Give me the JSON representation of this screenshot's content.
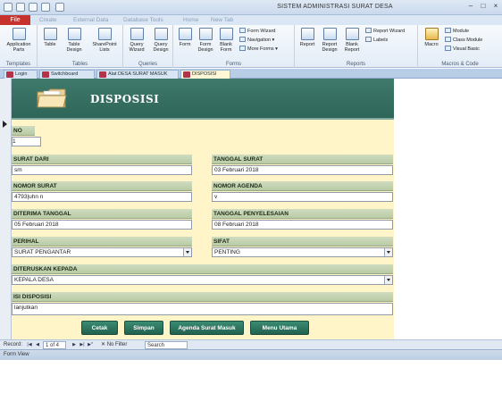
{
  "window": {
    "title": "SISTEM ADMINISTRASI SURAT DESA"
  },
  "ribbon": {
    "file_tab": "File",
    "tabs": [
      "Create",
      "External Data",
      "Database Tools",
      "Home",
      "New Tab"
    ],
    "groups": {
      "templates": {
        "label": "Templates",
        "buttons": [
          "Application Parts"
        ]
      },
      "tables": {
        "label": "Tables",
        "buttons": [
          "Table",
          "Table Design",
          "SharePoint Lists"
        ]
      },
      "queries": {
        "label": "Queries",
        "buttons": [
          "Query Wizard",
          "Query Design"
        ]
      },
      "forms": {
        "label": "Forms",
        "buttons": [
          "Form",
          "Form Design",
          "Blank Form"
        ],
        "small": [
          "Form Wizard",
          "Navigation",
          "More Forms"
        ]
      },
      "reports": {
        "label": "Reports",
        "buttons": [
          "Report",
          "Report Design",
          "Blank Report"
        ],
        "small": [
          "Report Wizard",
          "Labels"
        ]
      },
      "macros": {
        "label": "Macros & Code",
        "buttons": [
          "Macro"
        ],
        "small": [
          "Module",
          "Class Module",
          "Visual Basic"
        ]
      }
    }
  },
  "object_tabs": [
    "Login",
    "Switchboard",
    "Alat DESA SURAT MASUK",
    "DISPOSISI"
  ],
  "form": {
    "header_title": "DISPOSISI",
    "fields": {
      "no": {
        "label": "NO",
        "value": "1"
      },
      "surat_dari": {
        "label": "SURAT DARI",
        "value": "sm"
      },
      "tanggal_surat": {
        "label": "TANGGAL SURAT",
        "value": "03 Februari 2018"
      },
      "nomor_surat": {
        "label": "NOMOR SURAT",
        "value": "4793|uhn n"
      },
      "nomor_agenda": {
        "label": "NOMOR AGENDA",
        "value": "v"
      },
      "diterima_tanggal": {
        "label": "DITERIMA TANGGAL",
        "value": "05 Februari 2018"
      },
      "tanggal_penyelesaian": {
        "label": "TANGGAL PENYELESAIAN",
        "value": "08 Februari 2018"
      },
      "perihal": {
        "label": "PERIHAL",
        "value": "SURAT PENGANTAR"
      },
      "sifat": {
        "label": "SIFAT",
        "value": "PENTING"
      },
      "diteruskan_kepada": {
        "label": "DITERUSKAN KEPADA",
        "value": "KEPALA DESA"
      },
      "isi_disposisi": {
        "label": "ISI DISPOSISI",
        "value": "lanjutkan"
      }
    },
    "buttons": {
      "cetak": "Cetak",
      "simpan": "Simpan",
      "agenda": "Agenda Surat Masuk",
      "menu": "Menu  Utama"
    }
  },
  "navigation": {
    "record_label": "Record:",
    "position": "1 of 4",
    "filter": "No Filter",
    "search": "Search"
  },
  "status": {
    "view": "Form View"
  },
  "colors": {
    "header": "#2e6558",
    "detail_bg": "#fff5c8",
    "label_bg": "#b9cba5",
    "button": "#21614e",
    "file_tab": "#c7322c"
  }
}
